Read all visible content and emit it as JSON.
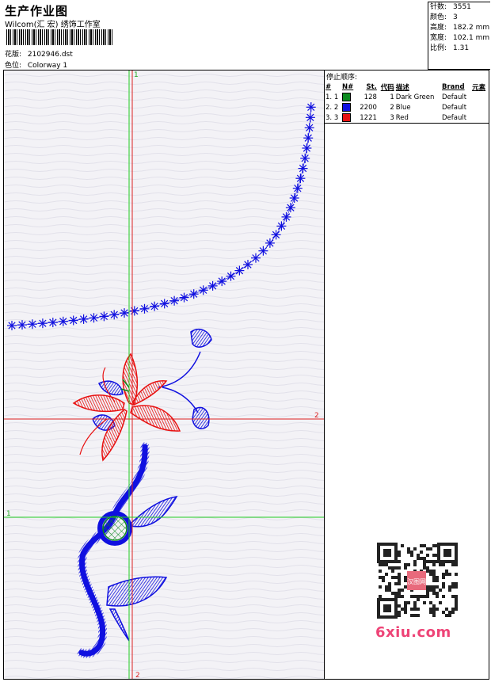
{
  "header": {
    "title": "生产作业图",
    "studio": "Wilcom(汇 宏) 绣饰工作室",
    "pattern_label": "花版:",
    "pattern_value": "2102946.dst",
    "colorway_label": "色位:",
    "colorway_value": "Colorway 1"
  },
  "info": {
    "stitches_label": "针数:",
    "stitches_value": "3551",
    "colors_label": "颜色:",
    "colors_value": "3",
    "height_label": "高度:",
    "height_value": "182.2 mm",
    "width_label": "宽度:",
    "width_value": "102.1 mm",
    "scale_label": "比例:",
    "scale_value": "1.31"
  },
  "stop_sequence": {
    "title": "停止顺序:",
    "headers": [
      "#",
      "N#",
      "St.",
      "代码",
      "描述",
      "Brand",
      "元素"
    ],
    "rows": [
      {
        "idx": "1.",
        "n": "1",
        "color": "#0a8a1e",
        "stitches": "128",
        "code": "1",
        "desc": "Dark Green",
        "brand": "Default"
      },
      {
        "idx": "2.",
        "n": "2",
        "color": "#1010e0",
        "stitches": "2200",
        "code": "2",
        "desc": "Blue",
        "brand": "Default"
      },
      {
        "idx": "3.",
        "n": "3",
        "color": "#e81010",
        "stitches": "1221",
        "code": "3",
        "desc": "Red",
        "brand": "Default"
      }
    ]
  },
  "guides": {
    "v1_label": "1",
    "v2_label": "2",
    "h1_label": "1",
    "h2_label": "2"
  },
  "watermark": "6xiu.com",
  "qr_stamp": "汉图网"
}
